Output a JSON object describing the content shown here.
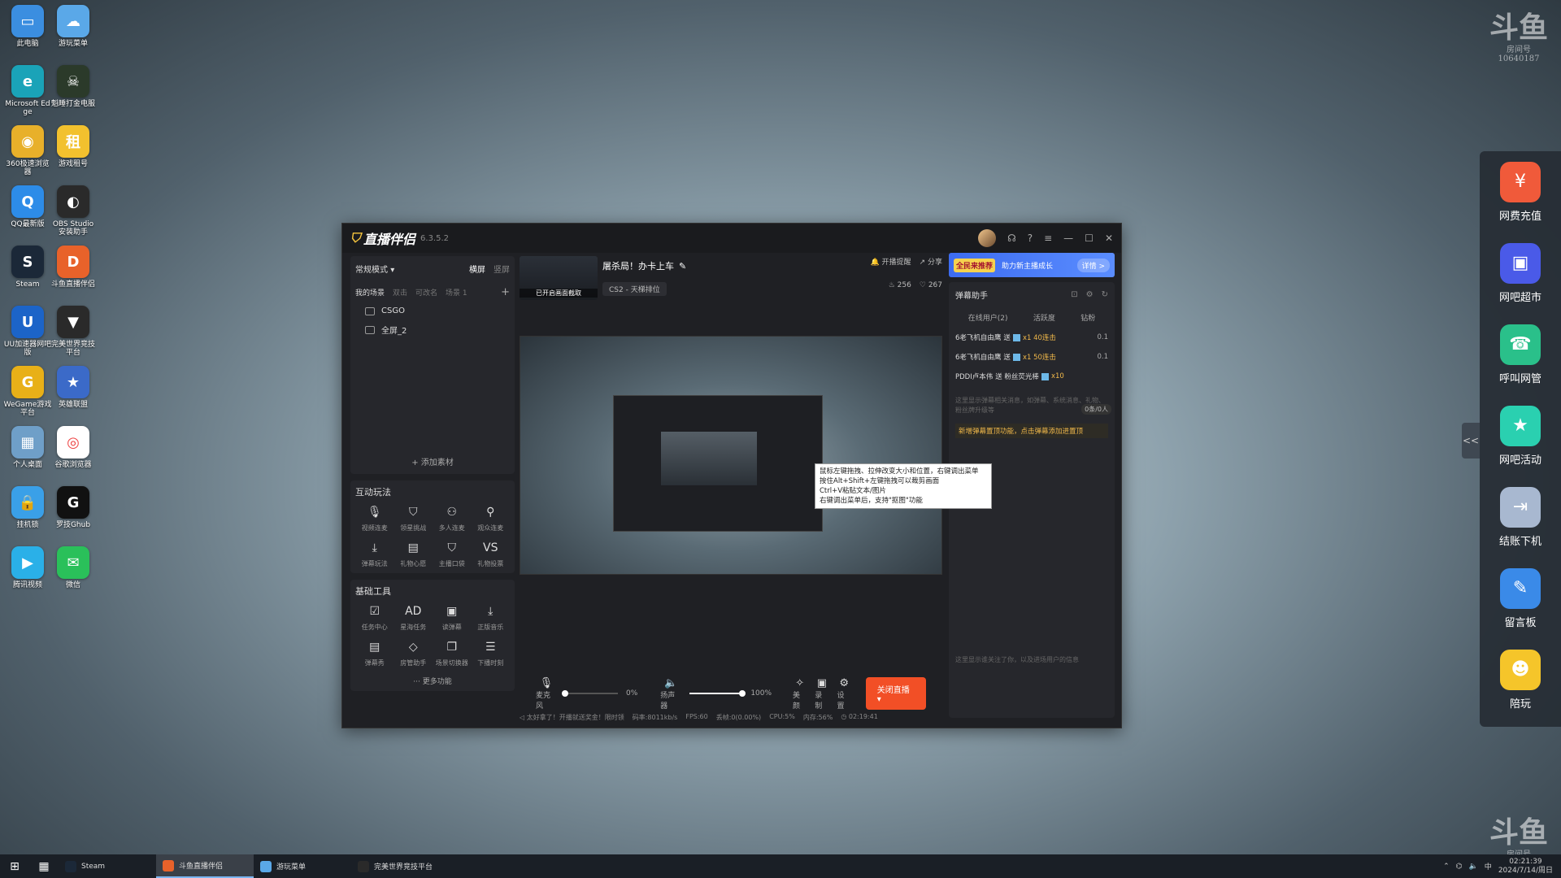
{
  "desktop": {
    "icons": [
      {
        "label": "此电脑",
        "color": "#3b8ee0",
        "glyph": "▭"
      },
      {
        "label": "游玩菜单",
        "color": "#5aa8e8",
        "glyph": "☁"
      },
      {
        "label": "Microsoft Edge",
        "color": "#1aa3b8",
        "glyph": "e"
      },
      {
        "label": "魁睡打金电服",
        "color": "#2b3a2a",
        "glyph": "☠"
      },
      {
        "label": "360极速浏览器",
        "color": "#e8b02a",
        "glyph": "◉"
      },
      {
        "label": "游戏租号",
        "color": "#f2c12e",
        "glyph": "租"
      },
      {
        "label": "QQ最新版",
        "color": "#2d8ce8",
        "glyph": "Q"
      },
      {
        "label": "OBS Studio 安装助手",
        "color": "#2a2a2a",
        "glyph": "◐"
      },
      {
        "label": "Steam",
        "color": "#1b2838",
        "glyph": "S"
      },
      {
        "label": "斗鱼直播伴侣",
        "color": "#e8622a",
        "glyph": "D"
      },
      {
        "label": "UU加速器网吧版",
        "color": "#1c64c8",
        "glyph": "U"
      },
      {
        "label": "完美世界竞技平台",
        "color": "#2a2a2a",
        "glyph": "▼"
      },
      {
        "label": "WeGame游戏平台",
        "color": "#e8b018",
        "glyph": "G"
      },
      {
        "label": "英雄联盟",
        "color": "#3b6ac8",
        "glyph": "★"
      },
      {
        "label": "个人桌面",
        "color": "#6f9fc8",
        "glyph": "▦"
      },
      {
        "label": "谷歌浏览器",
        "color": "#ffffff",
        "glyph": "◎"
      },
      {
        "label": "挂机锁",
        "color": "#3aa0e8",
        "glyph": "🔒"
      },
      {
        "label": "罗技Ghub",
        "color": "#111111",
        "glyph": "G"
      },
      {
        "label": "腾讯视频",
        "color": "#2ab0e8",
        "glyph": "▶"
      },
      {
        "label": "微信",
        "color": "#2ac05a",
        "glyph": "✉"
      }
    ]
  },
  "right_sidebar": {
    "items": [
      {
        "label": "网费充值",
        "color": "#f05a3a",
        "glyph": "¥"
      },
      {
        "label": "网吧超市",
        "color": "#4a5ae8",
        "glyph": "▣"
      },
      {
        "label": "呼叫网管",
        "color": "#2ac08a",
        "glyph": "☎"
      },
      {
        "label": "网吧活动",
        "color": "#2ad0b0",
        "glyph": "★"
      },
      {
        "label": "结账下机",
        "color": "#a8b8d0",
        "glyph": "⇥"
      },
      {
        "label": "留言板",
        "color": "#3a8ae8",
        "glyph": "✎"
      },
      {
        "label": "陪玩",
        "color": "#f5c52a",
        "glyph": "☻"
      }
    ],
    "collapse": "<<"
  },
  "watermark": {
    "logo": "斗鱼",
    "sub": "房间号",
    "room": "10640187"
  },
  "app": {
    "name": "直播伴侣",
    "version": "6.3.5.2",
    "mode": "常规模式",
    "orient_tabs": [
      "横屏",
      "竖屏"
    ],
    "scene_tabs": [
      "我的场景",
      "双击",
      "可改名",
      "场景 1"
    ],
    "sources": [
      "CSGO",
      "全屏_2"
    ],
    "add_material": "+ 添加素材",
    "interactive_title": "互动玩法",
    "interactive_tools": [
      {
        "label": "视频连麦",
        "glyph": "🎙"
      },
      {
        "label": "领星挑战",
        "glyph": "⛉"
      },
      {
        "label": "多人连麦",
        "glyph": "⚇"
      },
      {
        "label": "观众连麦",
        "glyph": "⚲"
      },
      {
        "label": "弹幕玩法",
        "glyph": "⤓"
      },
      {
        "label": "礼物心愿",
        "glyph": "▤"
      },
      {
        "label": "主播口袋",
        "glyph": "⛉"
      },
      {
        "label": "礼物投票",
        "glyph": "VS"
      }
    ],
    "basic_title": "基础工具",
    "basic_tools": [
      {
        "label": "任务中心",
        "glyph": "☑"
      },
      {
        "label": "星海任务",
        "glyph": "AD"
      },
      {
        "label": "读弹幕",
        "glyph": "▣"
      },
      {
        "label": "正版音乐",
        "glyph": "⤓"
      },
      {
        "label": "弹幕秀",
        "glyph": "▤"
      },
      {
        "label": "房管助手",
        "glyph": "◇"
      },
      {
        "label": "场景切换器",
        "glyph": "❐"
      },
      {
        "label": "下播时刻",
        "glyph": "☰"
      }
    ],
    "more": "··· 更多功能",
    "stream": {
      "thumb_caption": "已开启画面截取",
      "title": "屠杀局！办卡上车",
      "category": "CS2 - 天梯排位",
      "remind": "开播提醒",
      "share": "分享",
      "hot": "256",
      "likes": "267"
    },
    "tooltip": [
      "鼠标左键拖拽、拉伸改变大小和位置，右键调出菜单",
      "按住Alt+Shift+左键拖拽可以裁剪画面",
      "Ctrl+V粘贴文本/图片",
      "右键调出菜单后，支持\"抠图\"功能"
    ],
    "controls": {
      "mic_label": "麦克风",
      "mic_value": "0%",
      "mic_level": 0,
      "speaker_label": "扬声器",
      "speaker_value": "100%",
      "speaker_level": 1,
      "beauty": "美颜",
      "record": "录制",
      "settings": "设置",
      "go_live": "关闭直播"
    },
    "status": {
      "notice": "太好拿了！开播就送奖金！限时领",
      "bitrate": "码率:8011kb/s",
      "fps": "FPS:60",
      "drop": "丢帧:0(0.00%)",
      "cpu": "CPU:5%",
      "mem": "内存:56%",
      "time": "02:19:41"
    },
    "banner": {
      "badge": "全民来推荐",
      "text": "助力新主播成长",
      "detail": "详情 >"
    },
    "danmu": {
      "title": "弹幕助手",
      "tabs": [
        "在线用户(2)",
        "活跃度",
        "钻粉"
      ],
      "messages": [
        {
          "user": "6老飞机自由鹰",
          "act": "送 ",
          "gift": "x1 40连击",
          "val": "0.1"
        },
        {
          "user": "6老飞机自由鹰",
          "act": "送 ",
          "gift": "x1 50连击",
          "val": "0.1"
        },
        {
          "user": "PDDI卢本伟",
          "act": "送 粉丝荧光棒 ",
          "gift": "x10",
          "val": ""
        }
      ],
      "hint": "这里显示弹幕相关消息，如弹幕、系统消息、礼物、粉丝牌升级等",
      "viewer": "0条/0人",
      "notice": "新增弹幕置顶功能，点击弹幕添加进置顶",
      "bottom": "这里显示谁关注了你，以及进场用户的信息"
    }
  },
  "taskbar": {
    "items": [
      {
        "label": "Steam",
        "color": "#1b2838",
        "active": false
      },
      {
        "label": "斗鱼直播伴侣",
        "color": "#e8622a",
        "active": true
      },
      {
        "label": "游玩菜单",
        "color": "#5aa8e8",
        "active": false
      },
      {
        "label": "完美世界竞技平台",
        "color": "#2a2a2a",
        "active": false
      }
    ],
    "ime": "中",
    "time": "02:21:39",
    "date": "2024/7/14/周日"
  }
}
